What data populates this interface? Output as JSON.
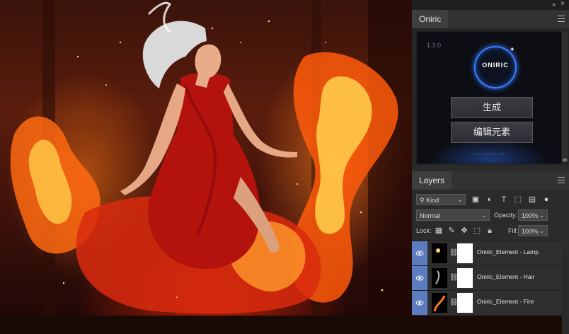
{
  "plugin_panel": {
    "tab_label": "Oniric",
    "version": "1.3.0",
    "logo_text": "ONIRIC",
    "generate_button": "生成",
    "edit_elements_button": "编辑元素",
    "url_text": "www.oniricsoft.com"
  },
  "layers_panel": {
    "tab_label": "Layers",
    "filter_kind": "Kind",
    "blend_mode": "Normal",
    "opacity_label": "Opacity:",
    "opacity_value": "100%",
    "lock_label": "Lock:",
    "fill_label": "Fill:",
    "fill_value": "100%",
    "layers": [
      {
        "name": "Oniric_Element - Lamp"
      },
      {
        "name": "Oniric_Element - Hair"
      },
      {
        "name": "Oniric_Element - Fire"
      }
    ]
  },
  "colors": {
    "panel_bg": "#2b2b2b",
    "eye_column_blue": "#5b7dbf",
    "oniric_accent": "#3b7cff"
  }
}
